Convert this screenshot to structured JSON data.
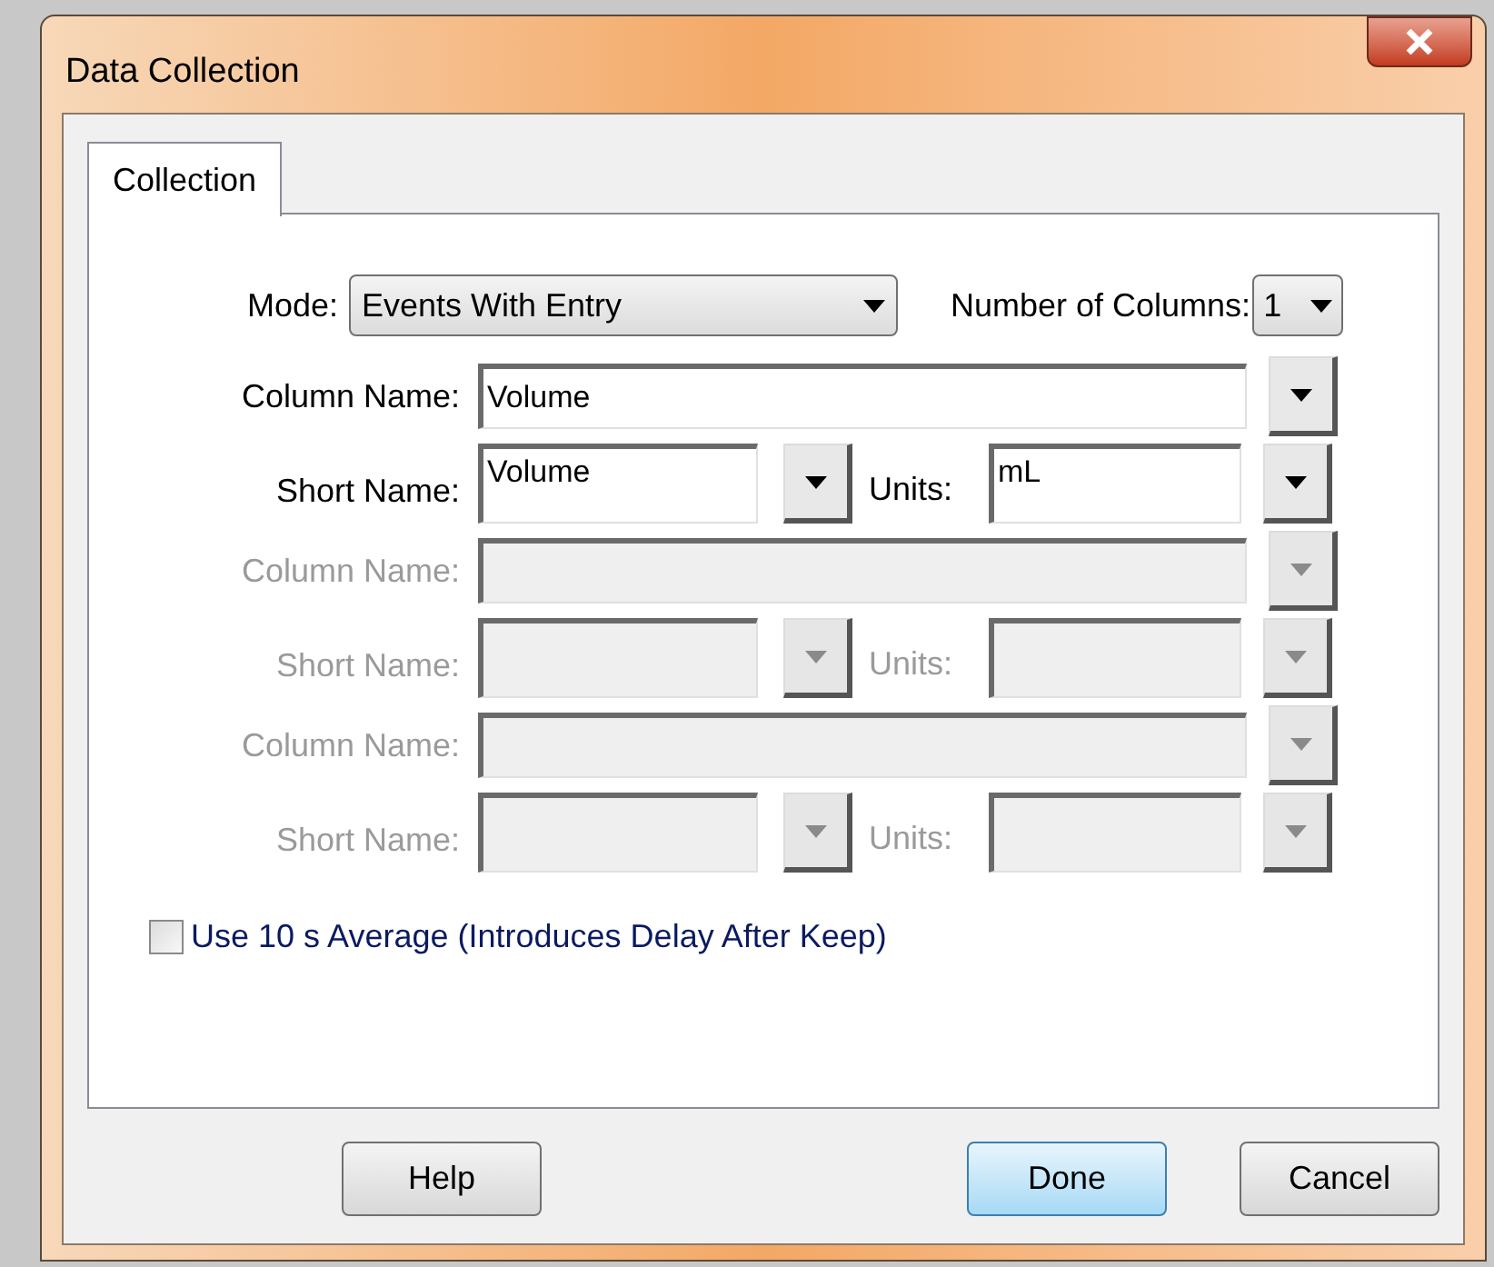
{
  "window": {
    "title": "Data Collection"
  },
  "tabs": [
    {
      "label": "Collection",
      "selected": true
    }
  ],
  "mode": {
    "label": "Mode:",
    "value": "Events With Entry"
  },
  "number_of_columns": {
    "label": "Number of Columns:",
    "value": "1"
  },
  "column_sets": [
    {
      "disabled": false,
      "column_name": {
        "label": "Column Name:",
        "value": "Volume"
      },
      "short_name": {
        "label": "Short Name:",
        "value": "Volume"
      },
      "units": {
        "label": "Units:",
        "value": "mL"
      }
    },
    {
      "disabled": true,
      "column_name": {
        "label": "Column Name:"
      },
      "short_name": {
        "label": "Short Name:"
      },
      "units": {
        "label": "Units:"
      }
    },
    {
      "disabled": true,
      "column_name": {
        "label": "Column Name:"
      },
      "short_name": {
        "label": "Short Name:"
      },
      "units": {
        "label": "Units:"
      }
    }
  ],
  "average_option": {
    "label": "Use 10 s Average (Introduces Delay After Keep)",
    "checked": false
  },
  "buttons": [
    {
      "label": "Help",
      "default": false
    },
    {
      "label": "Done",
      "default": true
    },
    {
      "label": "Cancel",
      "default": false
    }
  ]
}
